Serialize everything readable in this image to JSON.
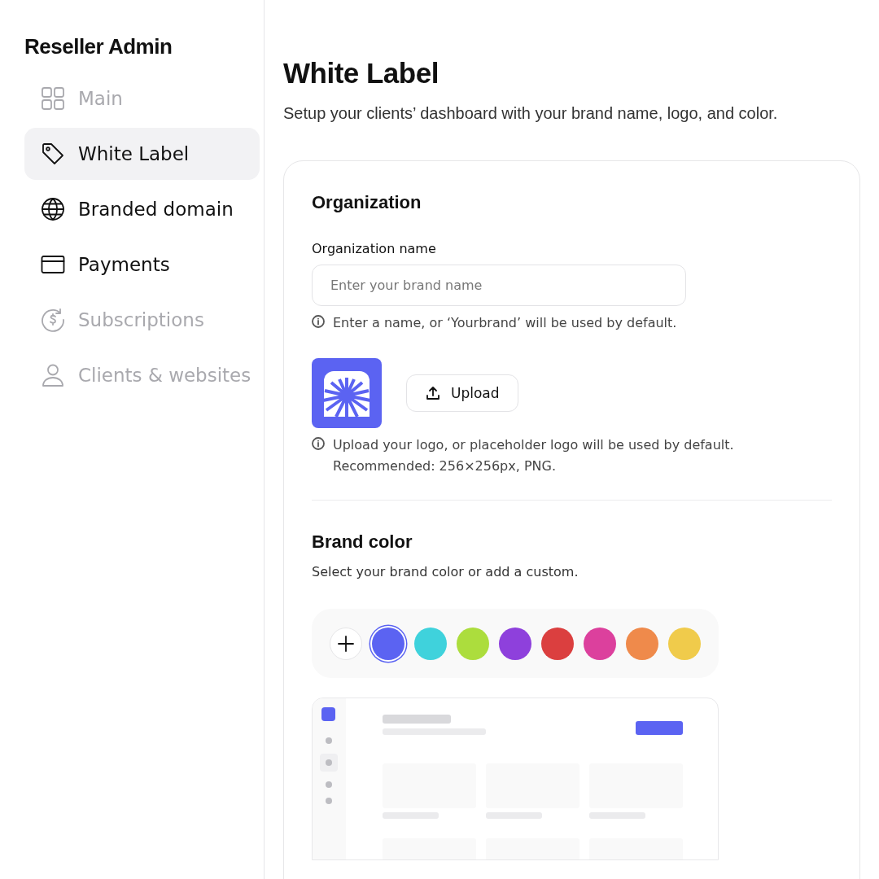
{
  "sidebar": {
    "title": "Reseller Admin",
    "items": [
      {
        "label": "Main",
        "selected": false,
        "disabled": true
      },
      {
        "label": "White Label",
        "selected": true,
        "disabled": false
      },
      {
        "label": "Branded domain",
        "selected": false,
        "disabled": false
      },
      {
        "label": "Payments",
        "selected": false,
        "disabled": false
      },
      {
        "label": "Subscriptions",
        "selected": false,
        "disabled": true
      },
      {
        "label": "Clients & websites",
        "selected": false,
        "disabled": true
      }
    ]
  },
  "page": {
    "title": "White Label",
    "subtitle": "Setup your clients’ dashboard with your brand name, logo, and color."
  },
  "organization": {
    "heading": "Organization",
    "name_label": "Organization name",
    "name_field": {
      "placeholder": "Enter your brand name"
    },
    "name_hint": "Enter a name, or ‘Yourbrand’ will be used by default.",
    "upload_button": "Upload",
    "logo_hint": [
      "Upload your logo, or placeholder logo will be used by default.",
      "Recommended: 256×256px, PNG."
    ]
  },
  "brand_color": {
    "heading": "Brand color",
    "description": "Select your brand color or add a custom.",
    "swatches": [
      {
        "color": "#5b63f2",
        "selected": true
      },
      {
        "color": "#3fd2dc",
        "selected": false
      },
      {
        "color": "#acdd3d",
        "selected": false
      },
      {
        "color": "#8e40dc",
        "selected": false
      },
      {
        "color": "#db3f3f",
        "selected": false
      },
      {
        "color": "#dc409d",
        "selected": false
      },
      {
        "color": "#ef8a4b",
        "selected": false
      },
      {
        "color": "#f0cb4b",
        "selected": false
      }
    ]
  }
}
